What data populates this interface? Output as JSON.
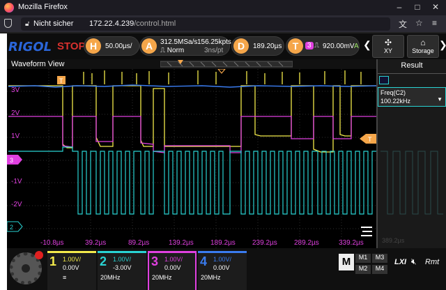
{
  "browser": {
    "title": "Mozilla Firefox",
    "not_secure": "Nicht sicher",
    "url_host": "172.22.4.239",
    "url_path": "/control.html"
  },
  "scope": {
    "brand": "RIGOL",
    "run_state": "STOP",
    "horizontal": {
      "letter": "H",
      "timebase": "50.00µs/"
    },
    "acquire": {
      "letter": "A",
      "sample_rate": "312.5MSa/s",
      "memory": "156.25kpts",
      "mode": "Norm",
      "resolution": "3ns/pt"
    },
    "delay": {
      "letter": "D",
      "value": "189.20µs"
    },
    "trigger": {
      "letter": "T",
      "source": "3",
      "level": "920.00mV",
      "coupling": "A"
    },
    "buttons": {
      "xy": "XY",
      "storage": "Storage"
    },
    "waveform_view": "Waveform View",
    "result": {
      "title": "Result",
      "measure": "Freq(C2)",
      "value": "100.22kHz"
    },
    "y_ticks": [
      "3V",
      "2V",
      "1V",
      "-1V",
      "-2V"
    ],
    "x_ticks": [
      "-10.8µs",
      "39.2µs",
      "89.2µs",
      "139.2µs",
      "189.2µs",
      "239.2µs",
      "289.2µs",
      "339.2µs"
    ],
    "ghost_x": "389.2µs",
    "markers": {
      "t": "T",
      "ch3": "3",
      "ch2": "2"
    },
    "channels": [
      {
        "num": "1",
        "scale": "1.00V/",
        "offset": "0.00V",
        "bw": "",
        "color": "#f4eb4b"
      },
      {
        "num": "2",
        "scale": "1.00V/",
        "offset": "-3.00V",
        "bw": "20MHz",
        "color": "#29d3d3"
      },
      {
        "num": "3",
        "scale": "1.00V/",
        "offset": "0.00V",
        "bw": "20MHz",
        "color": "#e040e0"
      },
      {
        "num": "4",
        "scale": "1.00V/",
        "offset": "0.00V",
        "bw": "20MHz",
        "color": "#3a7cf0"
      }
    ],
    "m_keys": {
      "m": "M",
      "m1": "M1",
      "m3": "M3",
      "m2": "M2",
      "m4": "M4"
    },
    "footer": {
      "lxi": "LXI",
      "rmt": "Rmt"
    }
  }
}
